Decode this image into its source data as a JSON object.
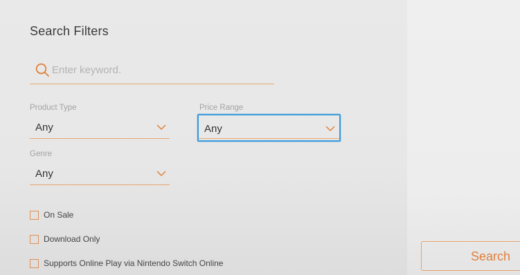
{
  "title": "Search Filters",
  "search": {
    "placeholder": "Enter keyword.",
    "value": ""
  },
  "filters": {
    "product_type": {
      "label": "Product Type",
      "value": "Any"
    },
    "price_range": {
      "label": "Price Range",
      "value": "Any"
    },
    "genre": {
      "label": "Genre",
      "value": "Any"
    }
  },
  "checkboxes": [
    {
      "label": "On Sale",
      "checked": false
    },
    {
      "label": "Download Only",
      "checked": false
    },
    {
      "label": "Supports Online Play via Nintendo Switch Online",
      "checked": false
    }
  ],
  "search_button": {
    "label": "Search"
  },
  "colors": {
    "accent": "#e0813d",
    "focus": "#3b9bdc",
    "background": "#e9e9e9"
  },
  "icons": {
    "search": "search-icon",
    "dropdown": "chevron-down-icon"
  }
}
